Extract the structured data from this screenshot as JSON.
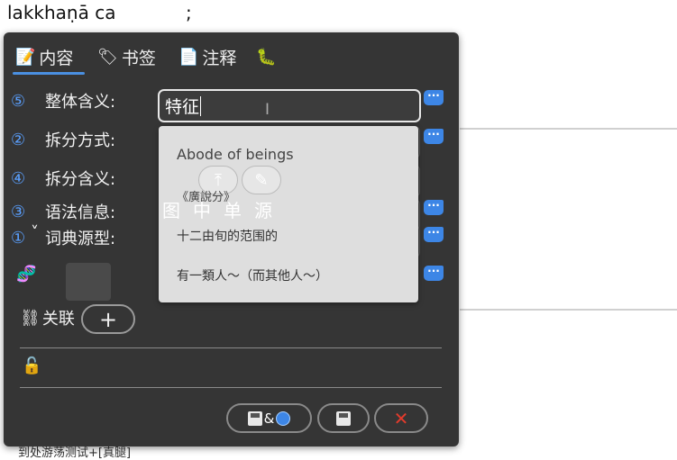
{
  "background": {
    "top_text": "lakkhaṇā  ca",
    "top_semicolon": ";",
    "bottom_text": "到处游荡测试+[真腿]"
  },
  "tabs": [
    {
      "label": "内容",
      "icon": "memo-icon"
    },
    {
      "label": "书签",
      "icon": "tag-icon"
    },
    {
      "label": "注释",
      "icon": "note-icon"
    },
    {
      "label": "",
      "icon": "caterpillar-icon"
    }
  ],
  "fields": [
    {
      "num": "⑤",
      "label": "整体含义:",
      "value": "特征"
    },
    {
      "num": "②",
      "label": "拆分方式:"
    },
    {
      "num": "④",
      "label": "拆分含义:"
    },
    {
      "num": "③",
      "label": "语法信息:"
    },
    {
      "num": "①",
      "chevron": "˅",
      "label": "词典源型:"
    }
  ],
  "dropdown": {
    "items": [
      "Abode of beings",
      "《廣說分》",
      "十二由旬的范围的",
      "有一類人～（而其他人～）"
    ],
    "overlay": "图中单源"
  },
  "link": {
    "label": "关联",
    "add": "+"
  },
  "footer": {
    "amp": "&"
  },
  "colors": {
    "panel": "#353535",
    "accent": "#3d86e6",
    "cancel": "#e23b2c"
  }
}
